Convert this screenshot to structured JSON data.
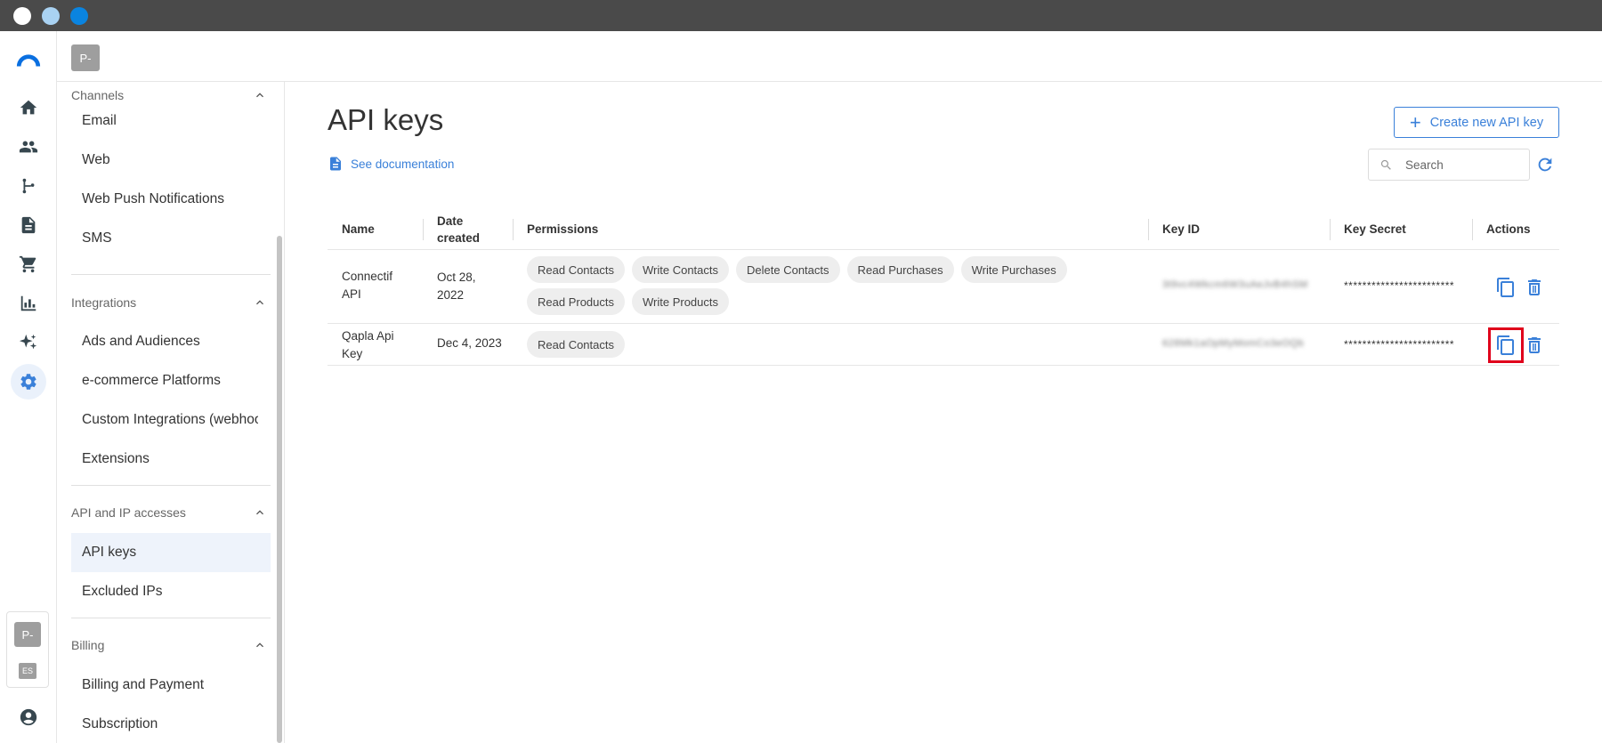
{
  "window": {
    "dot_colors": [
      "#ffffff",
      "#a9d2f2",
      "#0a84e0"
    ]
  },
  "topbar": {
    "account_badge": "P-"
  },
  "rail": {
    "items": [
      "logo-icon",
      "home-icon",
      "contacts-icon",
      "automation-icon",
      "document-icon",
      "cart-icon",
      "chart-icon",
      "sparkle-icon",
      "settings-icon"
    ],
    "account_badge": "P-",
    "language_badge": "ES"
  },
  "sidebar": {
    "sections": [
      {
        "title": "Channels",
        "items": [
          "Email",
          "Web",
          "Web Push Notifications",
          "SMS"
        ]
      },
      {
        "title": "Integrations",
        "items": [
          "Ads and Audiences",
          "e-commerce Platforms",
          "Custom Integrations (webhooks)",
          "Extensions"
        ]
      },
      {
        "title": "API and IP accesses",
        "items": [
          "API keys",
          "Excluded IPs"
        ]
      },
      {
        "title": "Billing",
        "items": [
          "Billing and Payment",
          "Subscription"
        ]
      }
    ],
    "active_item": "API keys"
  },
  "main": {
    "title": "API keys",
    "doc_link": "See documentation",
    "create_button": "Create new API key",
    "search_placeholder": "Search",
    "table": {
      "headers": {
        "name": "Name",
        "date_line1": "Date",
        "date_line2": "created",
        "permissions": "Permissions",
        "key_id": "Key ID",
        "key_secret": "Key Secret",
        "actions": "Actions"
      },
      "rows": [
        {
          "name_line1": "Connectif",
          "name_line2": "API",
          "date_line1": "Oct 28,",
          "date_line2": "2022",
          "permissions": [
            "Read Contacts",
            "Write Contacts",
            "Delete Contacts",
            "Read Purchases",
            "Write Purchases",
            "Read Products",
            "Write Products"
          ],
          "key_id": "3t9vc4Wkcm6W3uAeJvB4hSM",
          "key_secret": "************************"
        },
        {
          "name_line1": "Qapla Api",
          "name_line2": "Key",
          "date_line1": "Dec 4, 2023",
          "date_line2": "",
          "permissions": [
            "Read Contacts"
          ],
          "key_id": "628Mk1aOpMyMomCo3eOQb",
          "key_secret": "************************"
        }
      ]
    }
  },
  "colors": {
    "accent": "#3a80d9",
    "highlight": "#e0001b"
  }
}
